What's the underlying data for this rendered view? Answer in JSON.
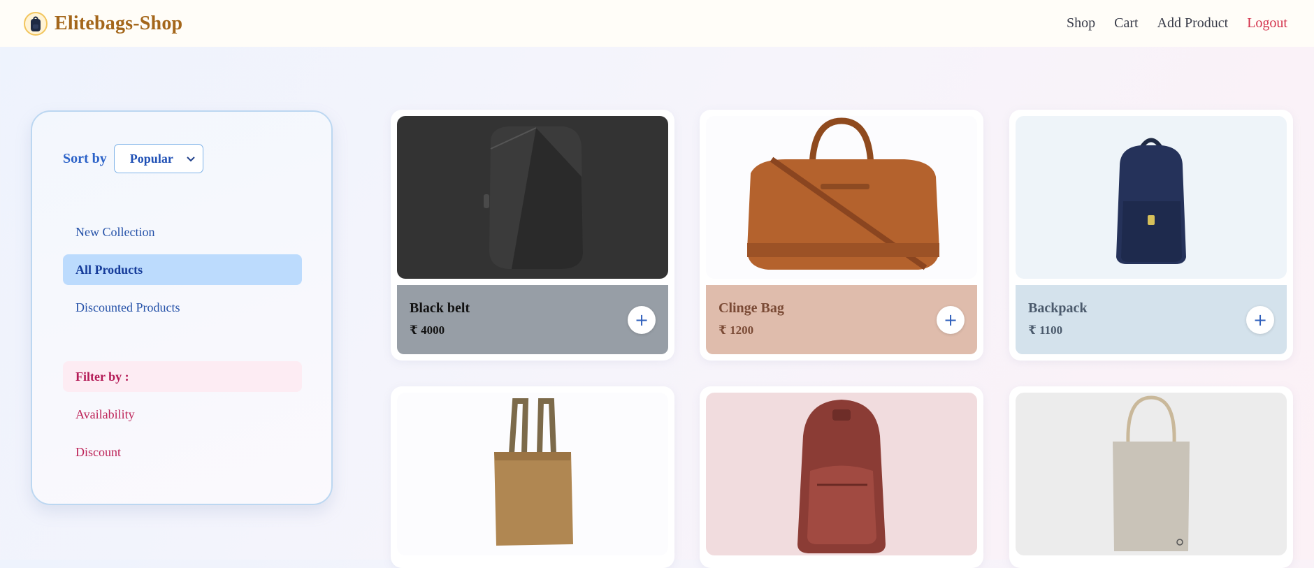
{
  "brand": {
    "name": "Elitebags-Shop",
    "logo_icon": "backpack-logo-icon"
  },
  "nav": [
    {
      "label": "Shop"
    },
    {
      "label": "Cart"
    },
    {
      "label": "Add Product"
    },
    {
      "label": "Logout",
      "color": "#d3304a"
    }
  ],
  "sidebar": {
    "sort_label": "Sort by",
    "sort_selected": "Popular",
    "categories": [
      {
        "label": "New Collection",
        "active": false
      },
      {
        "label": "All Products",
        "active": true
      },
      {
        "label": "Discounted Products",
        "active": false
      }
    ],
    "filter_heading": "Filter by :",
    "filters": [
      {
        "label": "Availability"
      },
      {
        "label": "Discount"
      }
    ]
  },
  "products": [
    {
      "name": "Black belt",
      "price": "₹ 4000",
      "image": "dark-geometric-backpack",
      "image_bg": "#333333",
      "panel_bg": "#979ea6",
      "text_color": "#111111"
    },
    {
      "name": "Clinge Bag",
      "price": "₹ 1200",
      "image": "brown-leather-duffel-bag",
      "image_bg": "#fcfcfe",
      "panel_bg": "#dfbcac",
      "text_color": "#7a4a35"
    },
    {
      "name": "Backpack",
      "price": "₹ 1100",
      "image": "navy-backpack",
      "image_bg": "#eef4f9",
      "panel_bg": "#d4e2ec",
      "text_color": "#4b5a6c"
    },
    {
      "name": "",
      "price": "",
      "image": "brown-tote-bag",
      "image_bg": "#fcfcfe",
      "panel_bg": "",
      "text_color": ""
    },
    {
      "name": "",
      "price": "",
      "image": "red-leather-backpack",
      "image_bg": "#f1dcde",
      "panel_bg": "",
      "text_color": ""
    },
    {
      "name": "",
      "price": "",
      "image": "canvas-tote-bag",
      "image_bg": "#ececec",
      "panel_bg": "",
      "text_color": ""
    }
  ]
}
